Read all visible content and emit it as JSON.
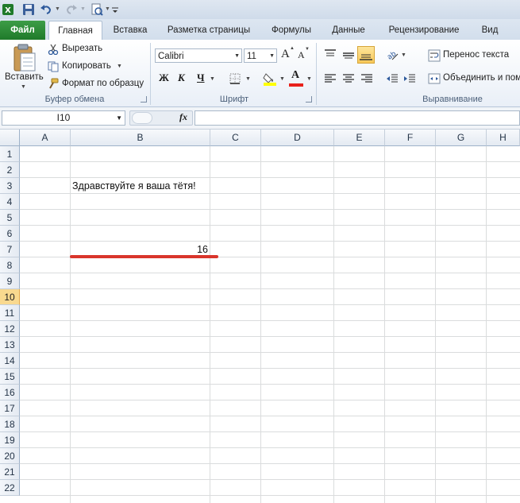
{
  "window": {
    "tabs": {
      "file": "Файл",
      "home": "Главная",
      "insert": "Вставка",
      "page_layout": "Разметка страницы",
      "formulas": "Формулы",
      "data": "Данные",
      "review": "Рецензирование",
      "view": "Вид"
    }
  },
  "ribbon": {
    "clipboard": {
      "paste": "Вставить",
      "cut": "Вырезать",
      "copy": "Копировать",
      "format_painter": "Формат по образцу",
      "group_label": "Буфер обмена"
    },
    "font": {
      "font_name": "Calibri",
      "font_size": "11",
      "bold": "Ж",
      "italic": "К",
      "underline": "Ч",
      "font_color_letter": "A",
      "grow_letter": "A",
      "shrink_letter": "A",
      "group_label": "Шрифт"
    },
    "alignment": {
      "wrap_text": "Перенос текста",
      "merge_center": "Объединить и пом",
      "group_label": "Выравнивание"
    }
  },
  "formula_bar": {
    "name_box": "I10",
    "fx": "fx",
    "formula": ""
  },
  "sheet": {
    "columns": [
      "A",
      "B",
      "C",
      "D",
      "E",
      "F",
      "G",
      "H"
    ],
    "rows": [
      "1",
      "2",
      "3",
      "4",
      "5",
      "6",
      "7",
      "8",
      "9",
      "10",
      "11",
      "12",
      "13",
      "14",
      "15",
      "16",
      "17",
      "18",
      "19",
      "20",
      "21",
      "22"
    ],
    "active_row": "10",
    "cells": {
      "B3": "Здравствуйте я ваша тётя!",
      "B7": "16"
    }
  },
  "colors": {
    "file_tab": "#2a8a35",
    "annotation_line": "#d9352b",
    "active_row_header": "#f9d98f"
  }
}
